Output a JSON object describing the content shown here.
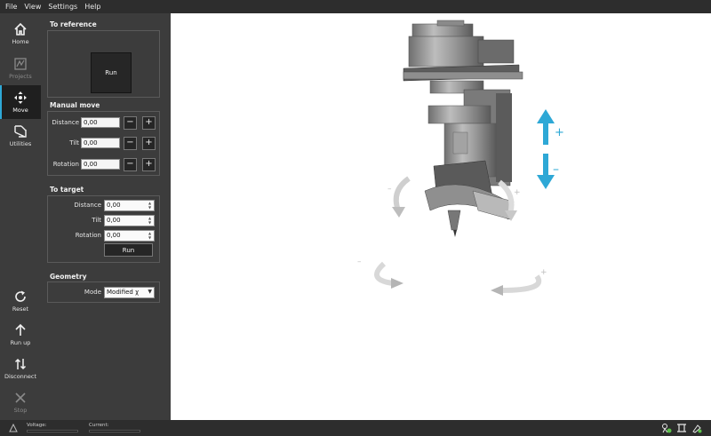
{
  "menu": [
    "File",
    "View",
    "Settings",
    "Help"
  ],
  "nav": {
    "home": "Home",
    "projects": "Projects",
    "move": "Move",
    "utilities": "Utilities",
    "reset": "Reset",
    "run_up": "Run up",
    "disconnect": "Disconnect",
    "stop": "Stop"
  },
  "to_reference": {
    "title": "To reference",
    "run_label": "Run"
  },
  "manual_move": {
    "title": "Manual move",
    "rows": [
      {
        "label": "Distance",
        "value": "0,00"
      },
      {
        "label": "Tilt",
        "value": "0,00"
      },
      {
        "label": "Rotation",
        "value": "0,00"
      }
    ],
    "minus": "−",
    "plus": "+"
  },
  "to_target": {
    "title": "To target",
    "rows": [
      {
        "label": "Distance",
        "value": "0,00"
      },
      {
        "label": "Tilt",
        "value": "0,00"
      },
      {
        "label": "Rotation",
        "value": "0,00"
      }
    ],
    "run_label": "Run"
  },
  "geometry": {
    "title": "Geometry",
    "mode_label": "Mode",
    "mode_value": "Modified χ"
  },
  "viewport": {
    "plus": "+",
    "minus": "–"
  },
  "status": {
    "voltage_label": "Voltage:",
    "current_label": "Current:"
  },
  "colors": {
    "accent": "#2ea8d6",
    "panel": "#3c3c3c",
    "menubar": "#2d2d2d",
    "status_ok": "#5cc24a"
  }
}
